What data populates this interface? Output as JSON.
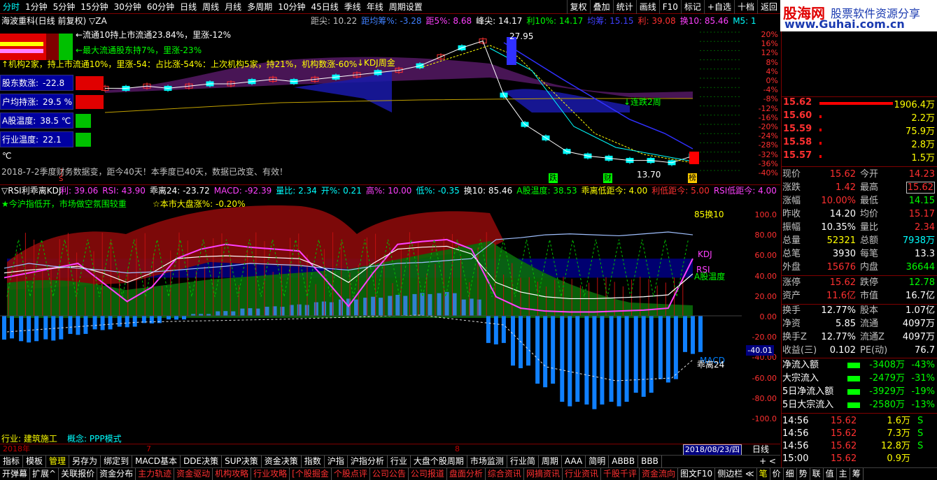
{
  "topbar": {
    "periods": [
      "分时",
      "1分钟",
      "5分钟",
      "15分钟",
      "30分钟",
      "60分钟",
      "日线",
      "周线",
      "月线",
      "多周期",
      "10分钟",
      "45日线",
      "季线",
      "年线",
      "周期设置"
    ],
    "active_index": 0,
    "buttons": [
      "复权",
      "叠加",
      "统计",
      "画线",
      "F10",
      "标记",
      "+自选",
      "十档",
      "返回"
    ]
  },
  "logo": {
    "brand": "股海网",
    "slogan": "股票软件资源分享",
    "url": "www.Guhai.com.cn"
  },
  "main": {
    "title": "海波重科(日线 前复权) ▽ZA",
    "indicators": [
      {
        "t": "距尖: 10.22",
        "c": "#c0c0c0"
      },
      {
        "t": "距均筹%: -3.28",
        "c": "#4080ff"
      },
      {
        "t": "距5%: 8.68",
        "c": "#ff40ff"
      },
      {
        "t": "峰尖: 14.17",
        "c": "#ffffff"
      },
      {
        "t": "利10%: 14.17",
        "c": "#00ff00"
      },
      {
        "t": "均筹: 15.15",
        "c": "#4040ff"
      },
      {
        "t": "利: 39.08",
        "c": "#ff3030"
      },
      {
        "t": "换10: 85.46",
        "c": "#ff40ff"
      },
      {
        "t": "M5: 1",
        "c": "#00ffff"
      }
    ],
    "ann_float10": "←流通10持上市流通23.84%，里涨-12%",
    "ann_maxholder": "←最大流通股东持7%，里涨-23%",
    "ann_institution": "↑机构2家，持上市流通10%，里涨-54：占比涨-54%：上次机构5家，持21%，机构数涨-60%",
    "ann_kdj": "↓KDJ周金",
    "ann_peak": "27.95",
    "ann_low": "13.70",
    "ann_lianjie": "↓连跌2周",
    "info": [
      {
        "label": "股东数涨:",
        "value": "-22.8 %"
      },
      {
        "label": "户均持涨:",
        "value": "29.5 %"
      },
      {
        "label": "A股温度:",
        "value": "38.5 ℃"
      },
      {
        "label": "行业温度:",
        "value": "22.1 ℃"
      }
    ],
    "report": "2018-7-2季度财务数据变，距今40天！本季度已40天，数据已改变、有效！",
    "markers": [
      "跌",
      "财",
      "榜"
    ],
    "s_marker": "S",
    "yaxis": [
      "20%",
      "16%",
      "12%",
      "8%",
      "4%",
      "0%",
      "-4%",
      "-8%",
      "-12%",
      "-16%",
      "-20%",
      "-24%",
      "-28%",
      "-32%",
      "-36%",
      "-40%"
    ]
  },
  "sub": {
    "title": "▽RSI利乖离KDJ",
    "indicators": [
      {
        "t": "利: 39.06",
        "c": "#ff40ff"
      },
      {
        "t": "RSI: 43.90",
        "c": "#ff40ff"
      },
      {
        "t": "乖离24: -23.72",
        "c": "#ffffff"
      },
      {
        "t": "MACD: -92.39",
        "c": "#ff40ff"
      },
      {
        "t": "量比: 2.34",
        "c": "#00ffff"
      },
      {
        "t": "开%: 0.21",
        "c": "#00ffff"
      },
      {
        "t": "高%: 10.00",
        "c": "#ff40ff"
      },
      {
        "t": "低%: -0.35",
        "c": "#00ffff"
      },
      {
        "t": "换10: 85.46",
        "c": "#ffffff"
      },
      {
        "t": "A股温度: 38.53",
        "c": "#00ff00"
      },
      {
        "t": "乖离低距今: 4.00",
        "c": "#ffff00"
      },
      {
        "t": "利低距今: 5.00",
        "c": "#ff3030"
      },
      {
        "t": "RSI低距今: 4.00",
        "c": "#ff40ff"
      }
    ],
    "note1": "★今沪指低开，市场做空氛围较重",
    "note2": "☆本市大盘涨%: -0.20%",
    "labels": {
      "huan10": "85换10",
      "kdj": "KDJ",
      "rsi": "RSI",
      "agwd": "A股温度",
      "macd": "MACD",
      "guaili": "乖离24"
    },
    "yaxis": [
      "100.0",
      "80.00",
      "60.00",
      "40.00",
      "20.00",
      "0.00",
      "-20.00",
      "-40.00",
      "-60.00",
      "-80.00",
      "-100.0"
    ],
    "cursor_value": "-40.01",
    "industry": "行业: 建筑施工",
    "concept": "概念: PPP模式"
  },
  "dateaxis": {
    "year": "2018年",
    "m7": "7",
    "m8": "8",
    "current": "2018/08/23/四",
    "period": "日线"
  },
  "tabs1": [
    "指标",
    "模板",
    "管理",
    "另存为",
    "绑定到",
    "MACD基本",
    "DDE决策",
    "SUP决策",
    "资金决策",
    "指数",
    "沪指",
    "沪指分析",
    "行业",
    "大盘个股周期",
    "市场监测",
    "行业简",
    "周期",
    "AAA",
    "简明",
    "ABBB",
    "BBB"
  ],
  "tabs1_active": 2,
  "tabs1_nav": "+ <",
  "tabs2": [
    "开弹幕",
    "扩展^",
    "关联报价",
    "资金分布",
    "主力轨迹",
    "资金驱动",
    "机构攻略",
    "行业攻略",
    "[个股掘金",
    "个股点评",
    "公司公告",
    "公司报道",
    "盘面分析",
    "综合资讯",
    "网摘资讯",
    "行业资讯",
    "千股千评",
    "资金流向",
    "图文F10",
    "侧边栏 ≪",
    "笔",
    "价",
    "细",
    "势",
    "联",
    "值",
    "主",
    "筹"
  ],
  "tabs2_red": [
    4,
    5,
    6,
    7,
    8,
    9,
    10,
    11,
    12,
    13,
    14,
    15,
    16,
    17
  ],
  "book": [
    {
      "price": "15.62",
      "vol": "1906.4万",
      "bar": 0.95
    },
    {
      "price": "15.60",
      "vol": "2.2万",
      "bar": 0
    },
    {
      "price": "15.59",
      "vol": "75.9万",
      "bar": 0
    },
    {
      "price": "15.58",
      "vol": "2.8万",
      "bar": 0
    },
    {
      "price": "15.57",
      "vol": "1.5万",
      "bar": 0
    }
  ],
  "quote": [
    {
      "k": "现价",
      "v": "15.62",
      "vc": "red",
      "k2": "今开",
      "v2": "14.23",
      "v2c": "red"
    },
    {
      "k": "涨跌",
      "v": "1.42",
      "vc": "red",
      "k2": "最高",
      "v2": "15.62",
      "v2c": "red",
      "box": true
    },
    {
      "k": "涨幅",
      "v": "10.00%",
      "vc": "red",
      "k2": "最低",
      "v2": "14.15",
      "v2c": "green"
    },
    {
      "k": "昨收",
      "v": "14.20",
      "vc": "white",
      "k2": "均价",
      "v2": "15.17",
      "v2c": "red"
    },
    {
      "k": "振幅",
      "v": "10.35%",
      "vc": "white",
      "k2": "量比",
      "v2": "2.34",
      "v2c": "red"
    },
    {
      "k": "总量",
      "v": "52321",
      "vc": "yellow",
      "k2": "总额",
      "v2": "7938万",
      "v2c": "cyan"
    },
    {
      "k": "总笔",
      "v": "3930",
      "vc": "white",
      "k2": "每笔",
      "v2": "13.3",
      "v2c": "white"
    },
    {
      "k": "外盘",
      "v": "15676",
      "vc": "red",
      "k2": "内盘",
      "v2": "36644",
      "v2c": "green"
    }
  ],
  "quote2": [
    {
      "k": "涨停",
      "v": "15.62",
      "vc": "red",
      "k2": "跌停",
      "v2": "12.78",
      "v2c": "green"
    },
    {
      "k": "资产",
      "v": "11.6亿",
      "vc": "red",
      "k2": "市值",
      "v2": "16.7亿",
      "v2c": "white"
    }
  ],
  "quote3": [
    {
      "k": "换手",
      "v": "12.77%",
      "vc": "white",
      "k2": "股本",
      "v2": "1.07亿",
      "v2c": "white"
    },
    {
      "k": "净资",
      "v": "5.85",
      "vc": "white",
      "k2": "流通",
      "v2": "4097万",
      "v2c": "white"
    },
    {
      "k": "换手Z",
      "v": "12.77%",
      "vc": "white",
      "k2": "流通Z",
      "v2": "4097万",
      "v2c": "white"
    },
    {
      "k": "收益(三)",
      "v": "0.102",
      "vc": "white",
      "k2": "PE(动)",
      "v2": "76.7",
      "v2c": "white"
    }
  ],
  "flows": [
    {
      "k": "净流入额",
      "v": "-3408万",
      "p": "-43%"
    },
    {
      "k": "大宗流入",
      "v": "-2479万",
      "p": "-31%"
    },
    {
      "k": "5日净流入额",
      "v": "-3929万",
      "p": "-19%"
    },
    {
      "k": "5日大宗流入",
      "v": "-2580万",
      "p": "-13%"
    }
  ],
  "ticks": [
    {
      "t": "14:56",
      "p": "15.62",
      "v": "1.6万",
      "s": "S"
    },
    {
      "t": "14:56",
      "p": "15.62",
      "v": "7.3万",
      "s": "S"
    },
    {
      "t": "14:56",
      "p": "15.62",
      "v": "12.8万",
      "s": "S"
    },
    {
      "t": "15:00",
      "p": "15.62",
      "v": "0.9万",
      "s": ""
    }
  ],
  "chart_data": [
    {
      "type": "line",
      "title": "海波重科(日线 前复权)",
      "ylabel": "",
      "ylim": [
        -40,
        22
      ],
      "series": [
        {
          "name": "close",
          "values": [
            -2,
            -2,
            -1,
            -2,
            -1,
            0,
            0,
            1,
            2,
            1,
            2,
            3,
            4,
            5,
            6,
            8,
            12,
            16,
            19,
            -5,
            -18,
            -24,
            -30,
            -32,
            -33,
            -34,
            -34,
            -35,
            -32
          ]
        }
      ]
    },
    {
      "type": "bar",
      "title": "RSI利乖离KDJ",
      "ylim": [
        -110,
        110
      ],
      "series": [
        {
          "name": "MACD",
          "values": [
            -25,
            -28,
            -26,
            -20,
            -15,
            -12,
            -8,
            -4,
            2,
            5,
            8,
            10,
            12,
            15,
            18,
            20,
            22,
            24,
            25,
            18,
            -30,
            -55,
            -75,
            -95,
            -98,
            -95,
            -85,
            -70,
            -40
          ]
        },
        {
          "name": "KDJ",
          "values": [
            40,
            45,
            50,
            55,
            35,
            15,
            30,
            60,
            70,
            75,
            72,
            70,
            68,
            40,
            10,
            45,
            75,
            78,
            80,
            70,
            20,
            8,
            5,
            4,
            4,
            5,
            6,
            8,
            60
          ]
        },
        {
          "name": "RSI",
          "values": [
            45,
            48,
            50,
            52,
            45,
            35,
            45,
            60,
            62,
            63,
            62,
            61,
            60,
            50,
            35,
            55,
            70,
            72,
            73,
            65,
            35,
            25,
            20,
            18,
            18,
            19,
            20,
            22,
            44
          ]
        },
        {
          "name": "换10",
          "values": [
            50,
            55,
            52,
            50,
            48,
            45,
            46,
            48,
            50,
            52,
            55,
            54,
            53,
            50,
            48,
            52,
            55,
            56,
            58,
            60,
            80,
            82,
            85,
            86,
            85,
            84,
            86,
            88,
            85
          ]
        }
      ]
    }
  ]
}
